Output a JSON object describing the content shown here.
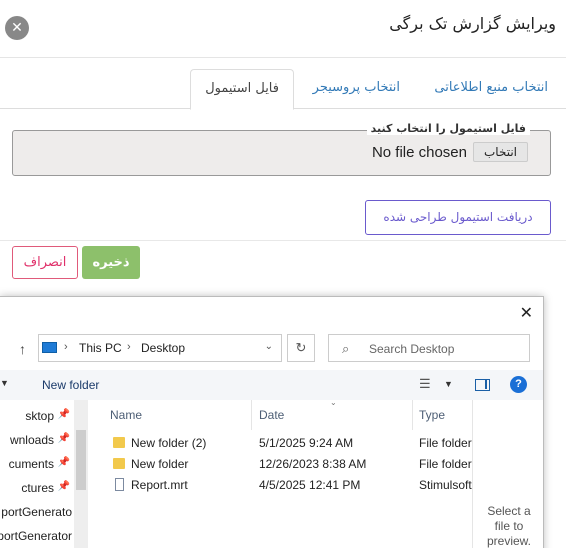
{
  "modal": {
    "title": "ویرایش گزارش تک برگی",
    "close_glyph": "✕"
  },
  "tabs": [
    {
      "label": "انتخاب منبع اطلاعاتی",
      "active": false
    },
    {
      "label": "انتخاب پروسیجر",
      "active": false
    },
    {
      "label": "فایل استیمول",
      "active": true
    }
  ],
  "file_field": {
    "legend": "فایل استیمول را انتخاب کنید",
    "choose_label": "انتخاب",
    "status": "No file chosen"
  },
  "buttons": {
    "download": "دریافت استیمول طراحی شده",
    "save": "ذخیره",
    "cancel": "انصراف"
  },
  "colors": {
    "accent_link": "#337ab7",
    "save_green": "#8dc06b",
    "cancel_pink": "#e0306a",
    "download_purple": "#6a5acd"
  },
  "dialog": {
    "close_glyph": "✕",
    "address": {
      "root": "This PC",
      "folder": "Desktop"
    },
    "search_placeholder": "Search Desktop",
    "toolbar": {
      "new_folder": "New folder"
    },
    "nav": [
      {
        "label": "Desktop",
        "display": "sktop",
        "pinned": true
      },
      {
        "label": "Downloads",
        "display": "wnloads",
        "pinned": true
      },
      {
        "label": "Documents",
        "display": "cuments",
        "pinned": true
      },
      {
        "label": "Pictures",
        "display": "ctures",
        "pinned": true
      },
      {
        "label": "ReportGenerator",
        "display": "portGenerato",
        "pinned": false
      },
      {
        "label": "ReportGenerator",
        "display": "portGenerator",
        "pinned": false
      }
    ],
    "columns": {
      "name": "Name",
      "date": "Date",
      "type": "Type"
    },
    "files": [
      {
        "name": "New folder (2)",
        "date": "5/1/2025 9:24 AM",
        "type": "File folder",
        "kind": "folder"
      },
      {
        "name": "New folder",
        "date": "12/26/2023 8:38 AM",
        "type": "File folder",
        "kind": "folder"
      },
      {
        "name": "Report.mrt",
        "date": "4/5/2025 12:41 PM",
        "type": "Stimulsoft",
        "kind": "file"
      }
    ],
    "preview_text": "Select a file to preview."
  }
}
